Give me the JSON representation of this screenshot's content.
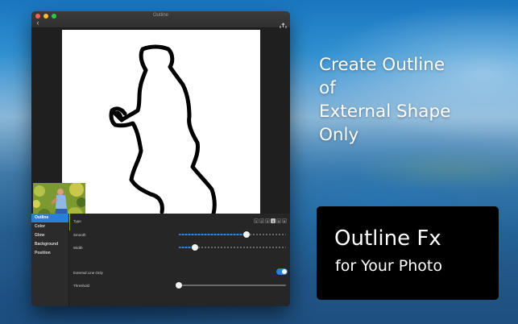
{
  "window": {
    "title": "Outline"
  },
  "icons": {
    "back": "chevron-left-icon",
    "export": "export-icon"
  },
  "sidebar": {
    "items": [
      {
        "label": "Outline",
        "active": true
      },
      {
        "label": "Color",
        "active": false
      },
      {
        "label": "Glow",
        "active": false
      },
      {
        "label": "Background",
        "active": false
      },
      {
        "label": "Position",
        "active": false
      }
    ]
  },
  "settings": {
    "type_label": "Type",
    "type_options": [
      "1",
      "2",
      "3",
      "4",
      "5",
      "6"
    ],
    "type_selected": "4",
    "smooth_label": "Smooth",
    "smooth_value": 0.63,
    "width_label": "Width",
    "width_value": 0.15,
    "external_label": "External Line Only",
    "external_on": true,
    "threshold_label": "Threshold",
    "threshold_value": 0.0
  },
  "promo": {
    "headline_lines": [
      "Create Outline",
      "of",
      "External Shape",
      "Only"
    ],
    "box_title": "Outline Fx",
    "box_subtitle": "for Your Photo"
  },
  "colors": {
    "accent": "#2a7fd7",
    "window_bg": "#262626",
    "promo_box": "#000000"
  }
}
